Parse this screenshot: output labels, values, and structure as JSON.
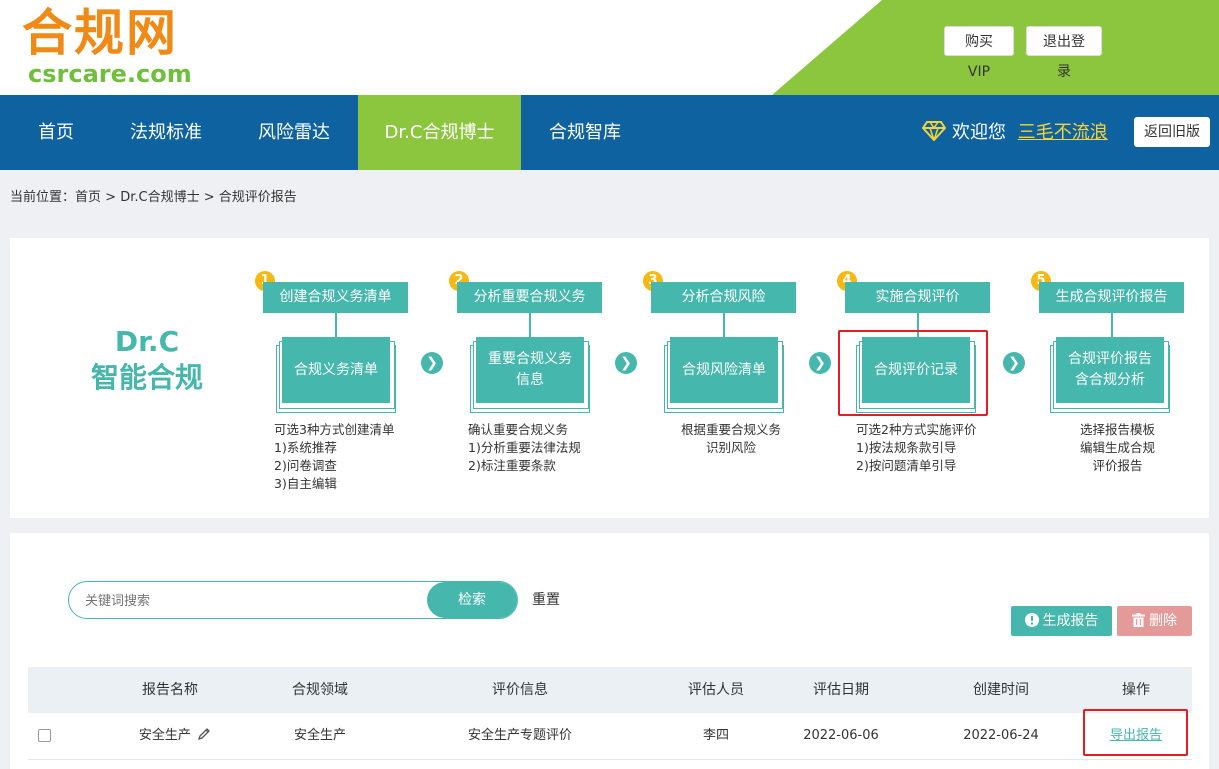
{
  "logo": {
    "cn": "合规网",
    "en": "csrcare.com"
  },
  "header": {
    "vip_label": "购买VIP",
    "logout_label": "退出登录"
  },
  "nav": {
    "items": [
      "首页",
      "法规标准",
      "风险雷达",
      "Dr.C合规博士",
      "合规智库"
    ],
    "active_index": 3,
    "welcome": "欢迎您",
    "username": "三毛不流浪",
    "old_version_label": "返回旧版"
  },
  "breadcrumb": {
    "prefix": "当前位置：",
    "items": [
      "首页",
      "Dr.C合规博士",
      "合规评价报告"
    ],
    "sep": ">"
  },
  "hero": {
    "title_line1": "Dr.C",
    "title_line2": "智能合规"
  },
  "steps": [
    {
      "num": "1",
      "head": "创建合规义务清单",
      "doc": "合规义务清单",
      "desc": "可选3种方式创建清单\n1)系统推荐\n2)问卷调查\n3)自主编辑"
    },
    {
      "num": "2",
      "head": "分析重要合规义务",
      "doc": "重要合规义务\n信息",
      "desc": "确认重要合规义务\n1)分析重要法律法规\n2)标注重要条款"
    },
    {
      "num": "3",
      "head": "分析合规风险",
      "doc": "合规风险清单",
      "desc": "根据重要合规义务\n识别风险"
    },
    {
      "num": "4",
      "head": "实施合规评价",
      "doc": "合规评价记录",
      "desc": "可选2种方式实施评价\n1)按法规条款引导\n2)按问题清单引导"
    },
    {
      "num": "5",
      "head": "生成合规评价报告",
      "doc": "合规评价报告\n含合规分析",
      "desc": "选择报告模板\n编辑生成合规\n评价报告"
    }
  ],
  "search": {
    "placeholder": "关键词搜索",
    "value": "",
    "button": "检索",
    "reset": "重置"
  },
  "actions": {
    "generate": "生成报告",
    "delete": "删除"
  },
  "table": {
    "headers": [
      "报告名称",
      "合规领域",
      "评价信息",
      "评估人员",
      "评估日期",
      "创建时间",
      "操作"
    ],
    "rows": [
      {
        "name": "安全生产",
        "domain": "安全生产",
        "info": "安全生产专题评价",
        "assessor": "李四",
        "assess_date": "2022-06-06",
        "created": "2022-06-24",
        "op": "导出报告"
      }
    ]
  },
  "colors": {
    "teal": "#46b7ad",
    "nav_blue": "#0f62a0",
    "green": "#8cc63f",
    "orange": "#f08a16",
    "highlight_red": "#e02020"
  }
}
